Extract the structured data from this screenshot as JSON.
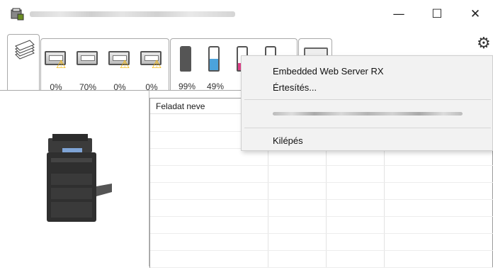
{
  "window": {
    "title": "",
    "min_glyph": "—",
    "max_glyph": "☐",
    "close_glyph": "✕"
  },
  "settings": {
    "icon": "gear-icon",
    "glyph": "⚙"
  },
  "paper_trays": [
    {
      "name": "tray-1",
      "level": "0%",
      "warning": true
    },
    {
      "name": "tray-2",
      "level": "70%",
      "warning": false
    },
    {
      "name": "tray-3",
      "level": "0%",
      "warning": true
    },
    {
      "name": "tray-4",
      "level": "0%",
      "warning": true
    }
  ],
  "toners": [
    {
      "name": "toner-black",
      "level": "99%",
      "fraction": 0.99,
      "color": "#555555"
    },
    {
      "name": "toner-cyan",
      "level": "49%",
      "fraction": 0.49,
      "color": "#4ba3dc"
    },
    {
      "name": "toner-magenta",
      "level": "",
      "fraction": 0.3,
      "color": "#e0408a"
    },
    {
      "name": "toner-yellow",
      "level": "",
      "fraction": 0.3,
      "color": "#e8d22a"
    }
  ],
  "job_list": {
    "column_header": "Feladat neve"
  },
  "context_menu": {
    "items": [
      "Embedded Web Server RX",
      "Értesítés...",
      "Kilépés"
    ]
  },
  "colors": {
    "warning": "#f4b400",
    "border": "#a9a9a9",
    "menu_bg": "#f2f2f2"
  }
}
